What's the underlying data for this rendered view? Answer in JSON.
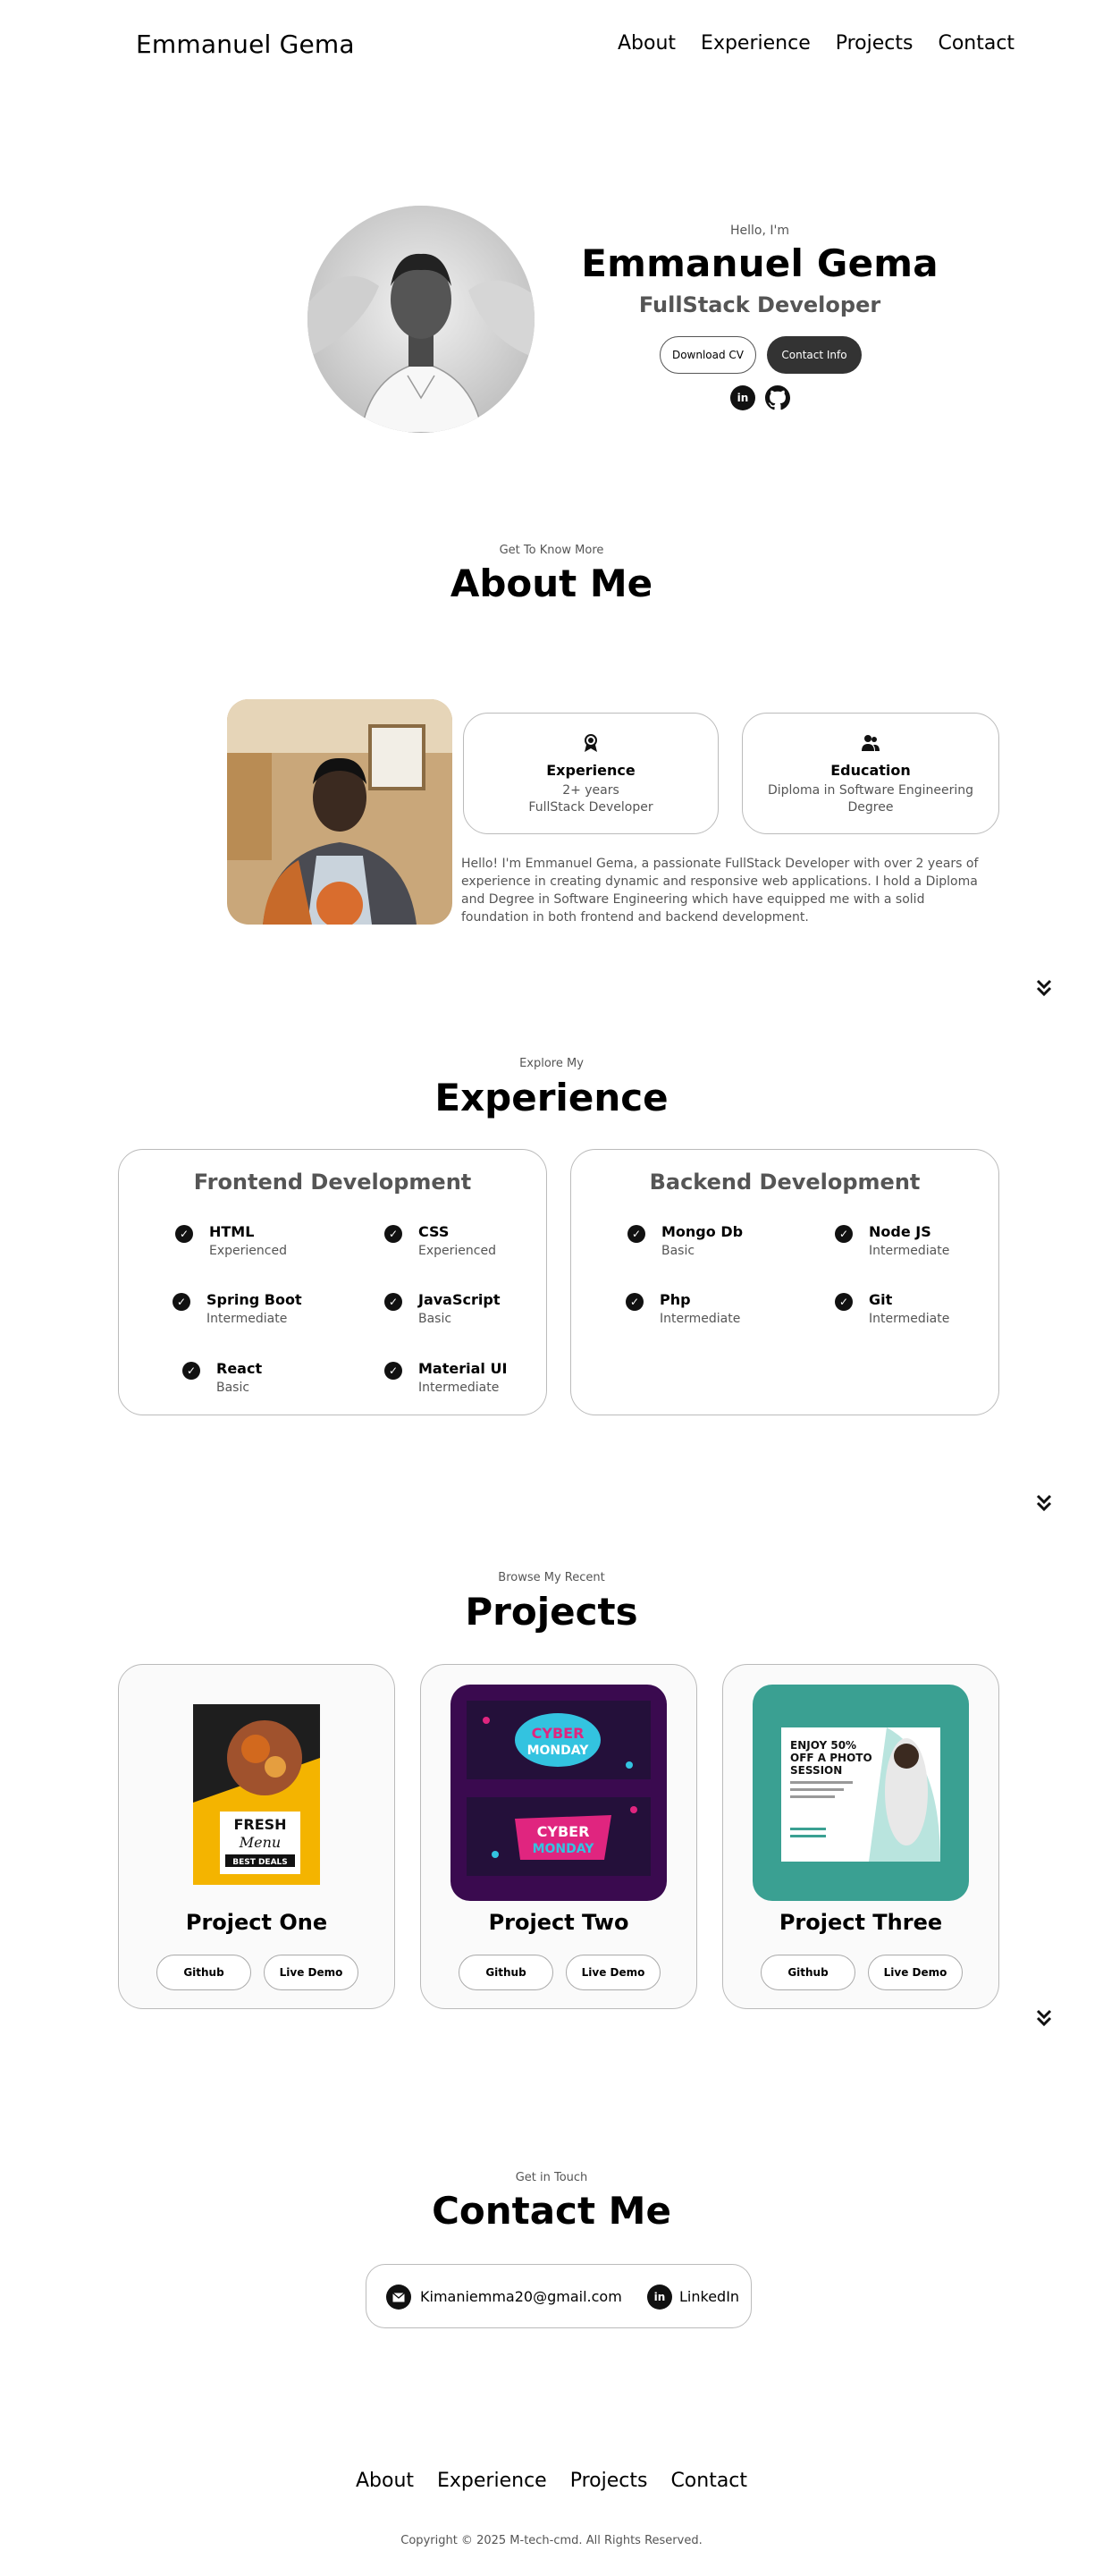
{
  "header": {
    "logo": "Emmanuel Gema",
    "nav": [
      "About",
      "Experience",
      "Projects",
      "Contact"
    ]
  },
  "hero": {
    "greeting": "Hello, I'm",
    "name": "Emmanuel Gema",
    "title": "FullStack Developer",
    "download_cv": "Download CV",
    "contact_info": "Contact Info",
    "socials": [
      "linkedin-icon",
      "github-icon"
    ]
  },
  "about": {
    "subtitle": "Get To Know More",
    "title": "About Me",
    "experience_card": {
      "title": "Experience",
      "lines": [
        "2+ years",
        "FullStack Developer"
      ]
    },
    "education_card": {
      "title": "Education",
      "lines": [
        "Diploma in Software Engineering",
        "Degree"
      ]
    },
    "paragraph": "Hello! I'm Emmanuel Gema, a passionate FullStack Developer with over 2 years of experience in creating dynamic and responsive web applications. I hold a Diploma and Degree in Software Engineering which have equipped me with a solid foundation in both frontend and backend development."
  },
  "experience": {
    "subtitle": "Explore My",
    "title": "Experience",
    "frontend": {
      "title": "Frontend Development",
      "skills": [
        {
          "name": "HTML",
          "level": "Experienced"
        },
        {
          "name": "CSS",
          "level": "Experienced"
        },
        {
          "name": "Spring Boot",
          "level": "Intermediate"
        },
        {
          "name": "JavaScript",
          "level": "Basic"
        },
        {
          "name": "React",
          "level": "Basic"
        },
        {
          "name": "Material UI",
          "level": "Intermediate"
        }
      ]
    },
    "backend": {
      "title": "Backend Development",
      "skills": [
        {
          "name": "Mongo Db",
          "level": "Basic"
        },
        {
          "name": "Node JS",
          "level": "Intermediate"
        },
        {
          "name": "Php",
          "level": "Intermediate"
        },
        {
          "name": "Git",
          "level": "Intermediate"
        }
      ]
    }
  },
  "projects": {
    "subtitle": "Browse My Recent",
    "title": "Projects",
    "items": [
      {
        "title": "Project One",
        "github": "Github",
        "demo": "Live Demo",
        "thumb_lines": [
          "FRESH",
          "Menu",
          "BEST DEALS"
        ]
      },
      {
        "title": "Project Two",
        "github": "Github",
        "demo": "Live Demo",
        "thumb_lines": [
          "CYBER",
          "MONDAY",
          "CYBER",
          "MONDAY"
        ]
      },
      {
        "title": "Project Three",
        "github": "Github",
        "demo": "Live Demo",
        "thumb_lines": [
          "ENJOY 50%",
          "OFF A PHOTO",
          "SESSION"
        ]
      }
    ]
  },
  "contact": {
    "subtitle": "Get in Touch",
    "title": "Contact Me",
    "email": "Kimaniemma20@gmail.com",
    "linkedin": "LinkedIn"
  },
  "footer": {
    "nav": [
      "About",
      "Experience",
      "Projects",
      "Contact"
    ],
    "copyright": "Copyright © 2025 M-tech-cmd. All Rights Reserved."
  },
  "colors": {
    "dark_button": "#333333",
    "muted_text": "#555555",
    "border": "#bbbbbb",
    "project2_bg": "#3a0a4f",
    "project3_bg": "#3aa092",
    "project1_accent": "#f4b400"
  }
}
